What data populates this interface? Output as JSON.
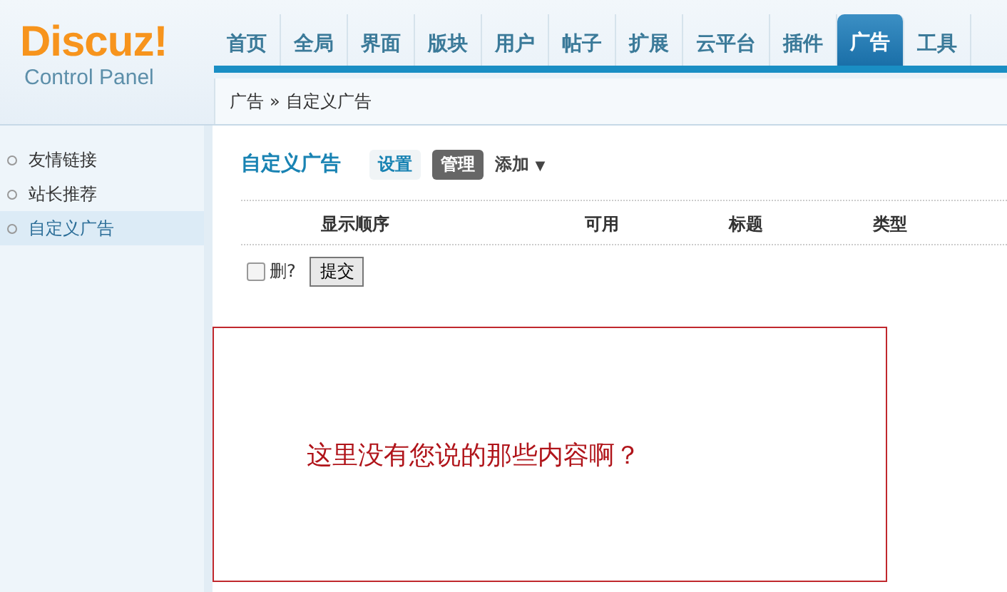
{
  "logo": {
    "brand": "Discuz!",
    "subtitle": "Control Panel"
  },
  "nav": [
    {
      "label": "首页",
      "selected": false
    },
    {
      "label": "全局",
      "selected": false
    },
    {
      "label": "界面",
      "selected": false
    },
    {
      "label": "版块",
      "selected": false
    },
    {
      "label": "用户",
      "selected": false
    },
    {
      "label": "帖子",
      "selected": false
    },
    {
      "label": "扩展",
      "selected": false
    },
    {
      "label": "云平台",
      "selected": false
    },
    {
      "label": "插件",
      "selected": false
    },
    {
      "label": "广告",
      "selected": true
    },
    {
      "label": "工具",
      "selected": false
    }
  ],
  "breadcrumb": {
    "items": [
      "广告",
      "自定义广告"
    ],
    "separator": "»"
  },
  "sidebar": {
    "items": [
      {
        "label": "友情链接",
        "selected": false
      },
      {
        "label": "站长推荐",
        "selected": false
      },
      {
        "label": "自定义广告",
        "selected": true
      }
    ]
  },
  "main": {
    "title": "自定义广告",
    "tabs": [
      {
        "label": "设置",
        "selected": false
      },
      {
        "label": "管理",
        "selected": true
      }
    ],
    "add_menu": {
      "label": "添加",
      "caret": "▼"
    },
    "table": {
      "columns": [
        "显示顺序",
        "可用",
        "标题",
        "类型"
      ]
    },
    "delete_checkbox": {
      "label": "删?",
      "checked": false
    },
    "submit": "提交"
  },
  "note": {
    "text": "这里没有您说的那些内容啊？"
  }
}
